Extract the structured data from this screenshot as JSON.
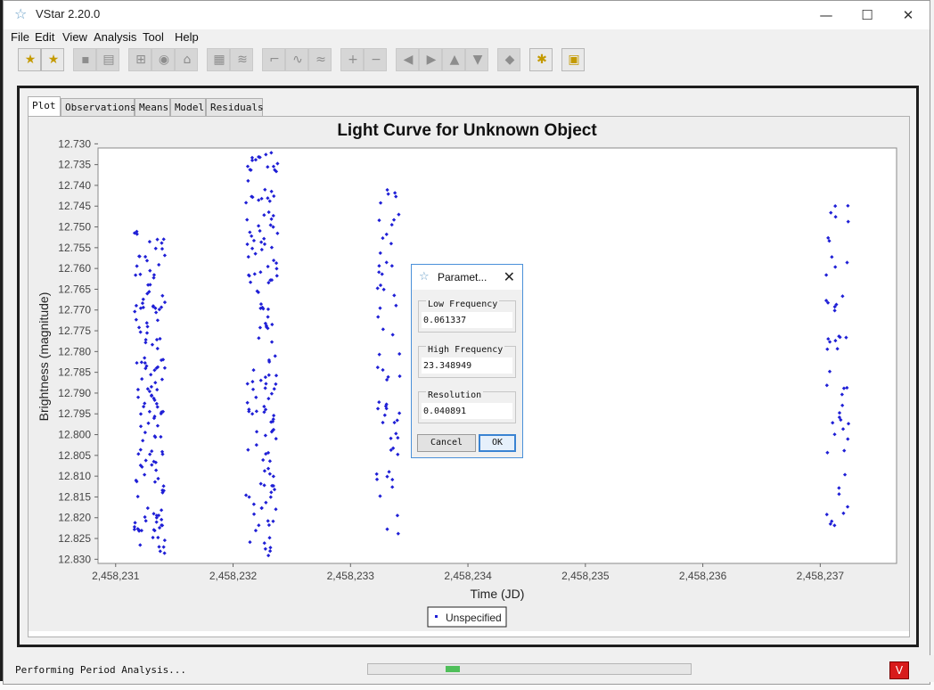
{
  "window": {
    "title": "VStar 2.20.0",
    "icon": "star-icon",
    "minimize": "—",
    "maximize": "☐",
    "close": "✕"
  },
  "menu": [
    "File",
    "Edit",
    "View",
    "Analysis",
    "Tool",
    "Help"
  ],
  "toolbar": {
    "buttons": [
      {
        "name": "new-star-button",
        "icon": "new-star-icon",
        "glyph": "★",
        "enabled": true
      },
      {
        "name": "open-folder-button",
        "icon": "folder-star-icon",
        "glyph": "★",
        "enabled": true
      },
      {
        "name": "save-button",
        "icon": "save-icon",
        "glyph": "▪",
        "enabled": false
      },
      {
        "name": "print-button",
        "icon": "print-icon",
        "glyph": "▤",
        "enabled": false
      },
      {
        "name": "info-button",
        "icon": "info-icon",
        "glyph": "⊞",
        "enabled": false
      },
      {
        "name": "view-details-button",
        "icon": "eye-icon",
        "glyph": "◉",
        "enabled": false
      },
      {
        "name": "filter-button",
        "icon": "filter-icon",
        "glyph": "⌂",
        "enabled": false
      },
      {
        "name": "phase-plot-button",
        "icon": "phase-icon",
        "glyph": "▦",
        "enabled": false
      },
      {
        "name": "wave-button",
        "icon": "wave-icon",
        "glyph": "≋",
        "enabled": false
      },
      {
        "name": "raw-plot-button",
        "icon": "plot-icon",
        "glyph": "⌐",
        "enabled": false
      },
      {
        "name": "means-plot-button",
        "icon": "means-icon",
        "glyph": "∿",
        "enabled": false
      },
      {
        "name": "model-plot-button",
        "icon": "model-icon",
        "glyph": "≈",
        "enabled": false
      },
      {
        "name": "zoom-in-button",
        "icon": "zoom-in-icon",
        "glyph": "+",
        "enabled": false
      },
      {
        "name": "zoom-out-button",
        "icon": "zoom-out-icon",
        "glyph": "−",
        "enabled": false
      },
      {
        "name": "back-button",
        "icon": "arrow-left-icon",
        "glyph": "◀",
        "enabled": false
      },
      {
        "name": "forward-button",
        "icon": "arrow-right-icon",
        "glyph": "▶",
        "enabled": false
      },
      {
        "name": "up-button",
        "icon": "arrow-up-icon",
        "glyph": "▲",
        "enabled": false
      },
      {
        "name": "down-button",
        "icon": "arrow-down-icon",
        "glyph": "▼",
        "enabled": false
      },
      {
        "name": "eraser-button",
        "icon": "eraser-icon",
        "glyph": "◆",
        "enabled": false
      },
      {
        "name": "plugin-button",
        "icon": "plugin-icon",
        "glyph": "✱",
        "enabled": true
      },
      {
        "name": "help-book-button",
        "icon": "book-icon",
        "glyph": "▣",
        "enabled": true
      }
    ]
  },
  "tabs": [
    "Plot",
    "Observations",
    "Means",
    "Model",
    "Residuals"
  ],
  "selected_tab": "Plot",
  "chart_data": {
    "type": "scatter",
    "title": "Light Curve for Unknown Object",
    "xlabel": "Time (JD)",
    "ylabel": "Brightness (magnitude)",
    "xlim": [
      2458230.85,
      2458237.65
    ],
    "ylim": [
      12.731,
      12.831
    ],
    "y_inverted": true,
    "x_ticks": [
      2458231,
      2458232,
      2458233,
      2458234,
      2458235,
      2458236,
      2458237
    ],
    "x_tick_labels": [
      "2,458,231",
      "2,458,232",
      "2,458,233",
      "2,458,234",
      "2,458,235",
      "2,458,236",
      "2,458,237"
    ],
    "y_ticks": [
      12.73,
      12.735,
      12.74,
      12.745,
      12.75,
      12.755,
      12.76,
      12.765,
      12.77,
      12.775,
      12.78,
      12.785,
      12.79,
      12.795,
      12.8,
      12.805,
      12.81,
      12.815,
      12.82,
      12.825,
      12.83
    ],
    "y_tick_labels": [
      "12.730",
      "12.735",
      "12.740",
      "12.745",
      "12.750",
      "12.755",
      "12.760",
      "12.765",
      "12.770",
      "12.775",
      "12.780",
      "12.785",
      "12.790",
      "12.795",
      "12.800",
      "12.805",
      "12.810",
      "12.815",
      "12.820",
      "12.825",
      "12.830"
    ],
    "legend": "bottom-center",
    "grid": false,
    "marker_color": "#1f1fd6",
    "series": [
      {
        "name": "Unspecified",
        "clusters": [
          {
            "t_min": 2458231.16,
            "t_max": 2458231.42,
            "m_min": 12.751,
            "m_max": 12.829,
            "n": 150
          },
          {
            "t_min": 2458232.11,
            "t_max": 2458232.38,
            "m_min": 12.731,
            "m_max": 12.831,
            "n": 150
          },
          {
            "t_min": 2458233.22,
            "t_max": 2458233.42,
            "m_min": 12.741,
            "m_max": 12.824,
            "n": 60
          },
          {
            "t_min": 2458237.05,
            "t_max": 2458237.25,
            "m_min": 12.744,
            "m_max": 12.824,
            "n": 50
          }
        ]
      }
    ]
  },
  "dialog": {
    "title": "Paramet...",
    "icon": "star-icon",
    "close": "✕",
    "fields": [
      {
        "label": "Low Frequency",
        "value": "0.061337"
      },
      {
        "label": "High Frequency",
        "value": "23.348949"
      },
      {
        "label": "Resolution",
        "value": "0.040891"
      }
    ],
    "cancel_label": "Cancel",
    "ok_label": "OK"
  },
  "status": {
    "text": "Performing Period Analysis...",
    "progress": 0.05,
    "icon": "vstar-logo-icon"
  },
  "colors": {
    "marker": "#1f1fd6",
    "accent": "#3a83d2",
    "status_icon": "#d81b1b"
  }
}
